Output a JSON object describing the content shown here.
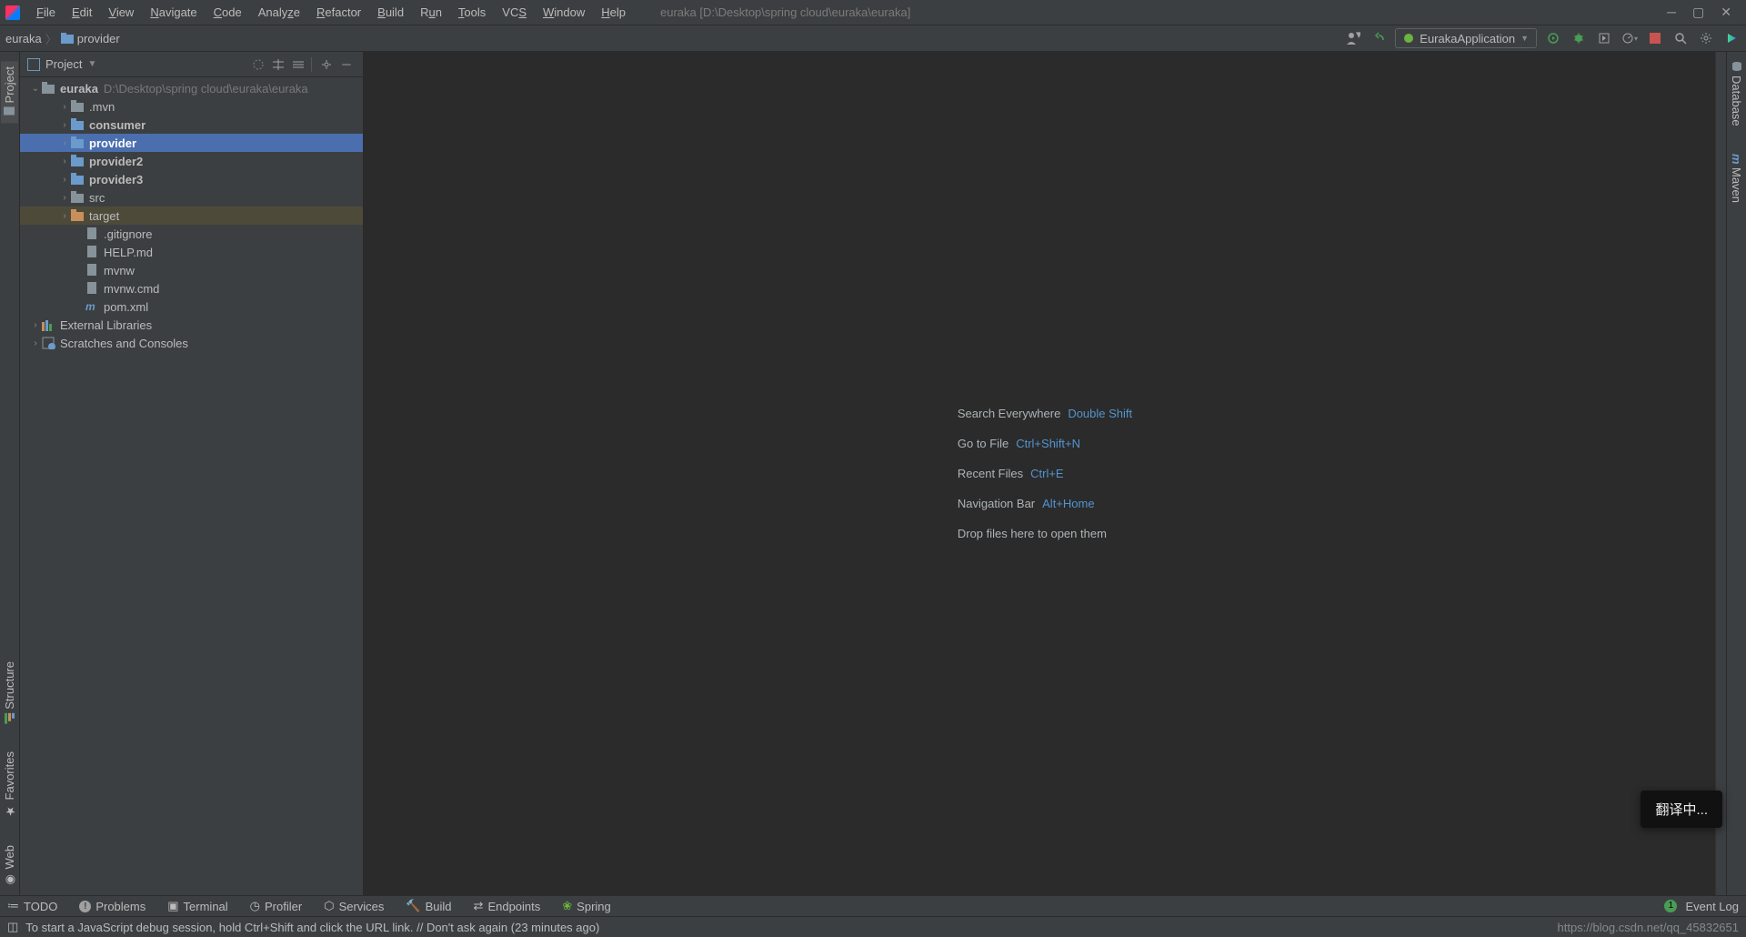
{
  "title": "euraka [D:\\Desktop\\spring cloud\\euraka\\euraka]",
  "menu": [
    "File",
    "Edit",
    "View",
    "Navigate",
    "Code",
    "Analyze",
    "Refactor",
    "Build",
    "Run",
    "Tools",
    "VCS",
    "Window",
    "Help"
  ],
  "breadcrumb": {
    "root": "euraka",
    "current": "provider"
  },
  "runConfig": "EurakaApplication",
  "project": {
    "title": "Project",
    "tree": {
      "root": {
        "label": "euraka",
        "path": "D:\\Desktop\\spring cloud\\euraka\\euraka"
      },
      "children": [
        {
          "label": ".mvn",
          "type": "folder",
          "indent": 2
        },
        {
          "label": "consumer",
          "type": "folder-blue",
          "bold": true,
          "indent": 2
        },
        {
          "label": "provider",
          "type": "folder-blue",
          "bold": true,
          "indent": 2,
          "selected": true
        },
        {
          "label": "provider2",
          "type": "folder-blue",
          "bold": true,
          "indent": 2
        },
        {
          "label": "provider3",
          "type": "folder-blue",
          "bold": true,
          "indent": 2
        },
        {
          "label": "src",
          "type": "folder",
          "indent": 2
        },
        {
          "label": "target",
          "type": "folder-orange",
          "indent": 2,
          "target": true
        },
        {
          "label": ".gitignore",
          "type": "file",
          "indent": 3,
          "leaf": true
        },
        {
          "label": "HELP.md",
          "type": "file",
          "indent": 3,
          "leaf": true
        },
        {
          "label": "mvnw",
          "type": "file",
          "indent": 3,
          "leaf": true
        },
        {
          "label": "mvnw.cmd",
          "type": "file",
          "indent": 3,
          "leaf": true
        },
        {
          "label": "pom.xml",
          "type": "file-m",
          "indent": 3,
          "leaf": true
        }
      ],
      "external": "External Libraries",
      "scratches": "Scratches and Consoles"
    }
  },
  "leftStripe": {
    "top": "Project",
    "structure": "Structure",
    "favorites": "Favorites",
    "web": "Web"
  },
  "rightStripe": {
    "database": "Database",
    "maven": "Maven"
  },
  "hints": [
    {
      "label": "Search Everywhere",
      "shortcut": "Double Shift"
    },
    {
      "label": "Go to File",
      "shortcut": "Ctrl+Shift+N"
    },
    {
      "label": "Recent Files",
      "shortcut": "Ctrl+E"
    },
    {
      "label": "Navigation Bar",
      "shortcut": "Alt+Home"
    },
    {
      "label": "Drop files here to open them",
      "shortcut": ""
    }
  ],
  "toast": "翻译中...",
  "bottomTools": [
    "TODO",
    "Problems",
    "Terminal",
    "Profiler",
    "Services",
    "Build",
    "Endpoints",
    "Spring"
  ],
  "eventLog": "Event Log",
  "status": "To start a JavaScript debug session, hold Ctrl+Shift and click the URL link. // Don't ask again (23 minutes ago)",
  "watermark": "https://blog.csdn.net/qq_45832651"
}
